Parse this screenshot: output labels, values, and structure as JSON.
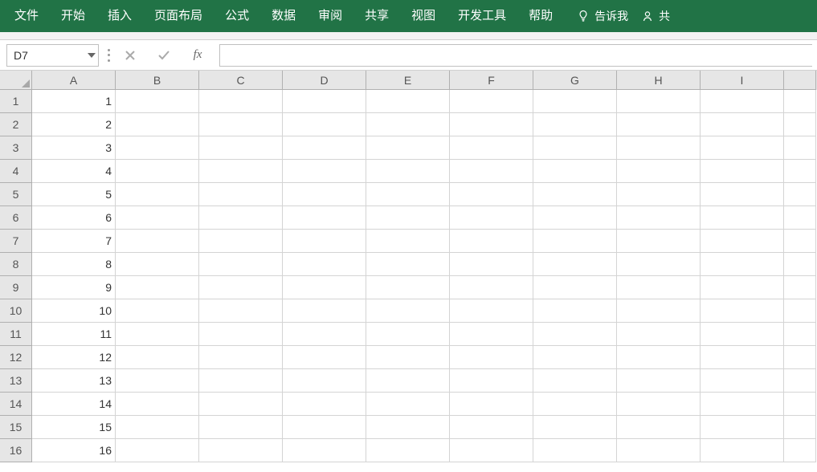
{
  "ribbon": {
    "tabs": [
      "文件",
      "开始",
      "插入",
      "页面布局",
      "公式",
      "数据",
      "审阅",
      "共享",
      "视图",
      "开发工具",
      "帮助"
    ],
    "tellme": "告诉我",
    "share": "共"
  },
  "formulaBar": {
    "nameBox": "D7",
    "fx": "fx",
    "formula": ""
  },
  "grid": {
    "columns": [
      "A",
      "B",
      "C",
      "D",
      "E",
      "F",
      "G",
      "H",
      "I"
    ],
    "rows": [
      1,
      2,
      3,
      4,
      5,
      6,
      7,
      8,
      9,
      10,
      11,
      12,
      13,
      14,
      15,
      16
    ],
    "data": {
      "A": [
        1,
        2,
        3,
        4,
        5,
        6,
        7,
        8,
        9,
        10,
        11,
        12,
        13,
        14,
        15,
        16
      ]
    }
  }
}
